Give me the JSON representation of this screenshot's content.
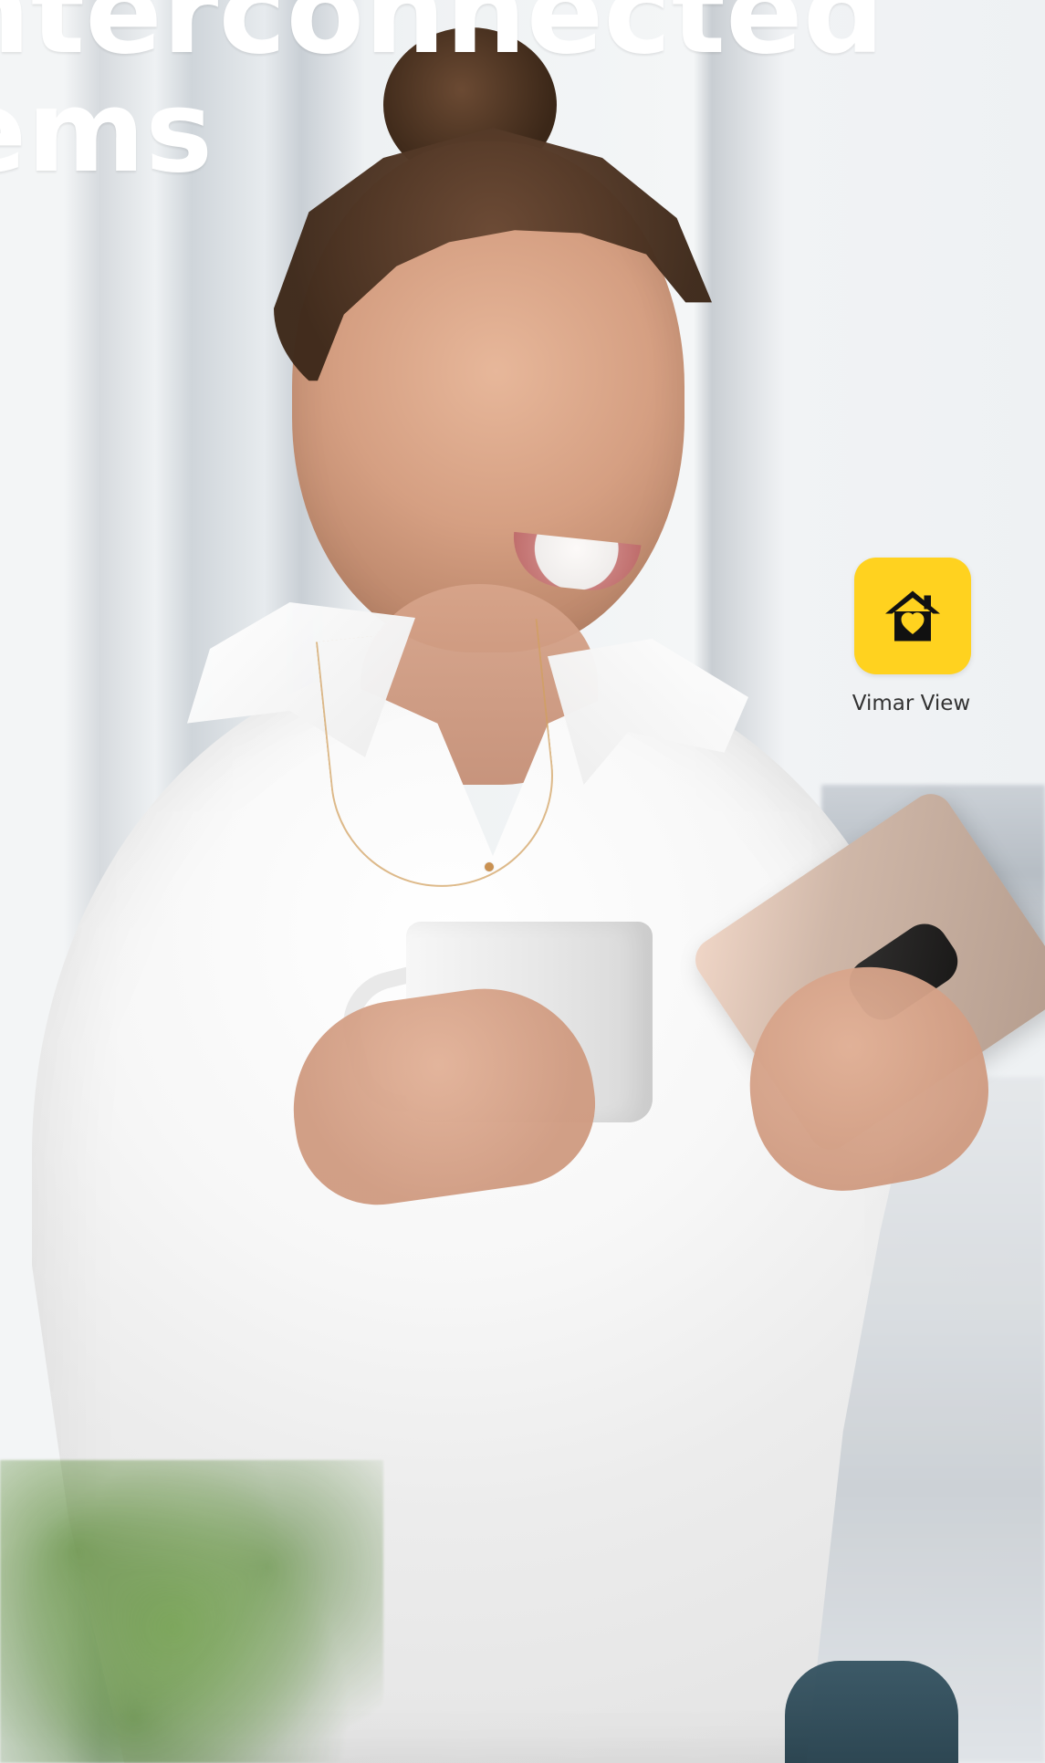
{
  "headline": {
    "line1": "nterconnected",
    "line2": "ems"
  },
  "app": {
    "name": "Vimar View",
    "icon": "house-heart-icon",
    "badge_color": "#ffd21f"
  }
}
